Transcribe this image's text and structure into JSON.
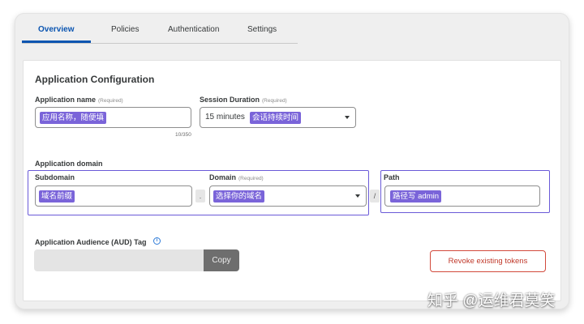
{
  "tabs": [
    {
      "label": "Overview",
      "active": true
    },
    {
      "label": "Policies",
      "active": false
    },
    {
      "label": "Authentication",
      "active": false
    },
    {
      "label": "Settings",
      "active": false
    }
  ],
  "accent_color": "#0b55b1",
  "highlight_color": "#7a64d9",
  "section_title": "Application Configuration",
  "app_name": {
    "label": "Application name",
    "required_note": "(Required)",
    "value": "应用名称，随便填",
    "counter": "10/350"
  },
  "session_duration": {
    "label": "Session Duration",
    "required_note": "(Required)",
    "value": "15 minutes",
    "annotation": "会话持续时间"
  },
  "app_domain": {
    "label": "Application domain",
    "subdomain": {
      "label": "Subdomain",
      "value": "域名前缀"
    },
    "separator_dot": ".",
    "domain": {
      "label": "Domain",
      "required_note": "(Required)",
      "value": "选择你的域名"
    },
    "separator_slash": "/",
    "path": {
      "label": "Path",
      "value": "路径写 admin"
    }
  },
  "aud_tag": {
    "label": "Application Audience (AUD) Tag",
    "info_icon": "i",
    "copy_label": "Copy"
  },
  "revoke_label": "Revoke existing tokens",
  "watermark": "知乎 @运维君莫笑"
}
